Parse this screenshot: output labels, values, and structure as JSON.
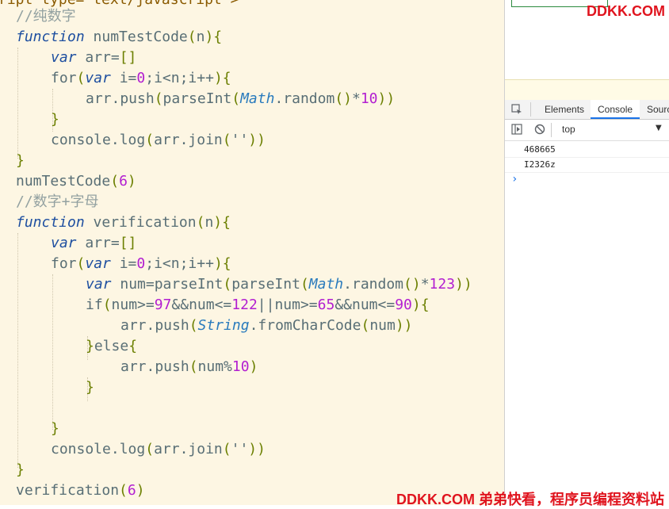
{
  "editor": {
    "lines": [
      "ript type=\"text/javascript\">",
      "//纯数字",
      "function numTestCode(n){",
      "var arr=[]",
      "for(var i=0;i<n;i++){",
      "arr.push(parseInt(Math.random()*10))",
      "}",
      "console.log(arr.join(''))",
      "}",
      "numTestCode(6)",
      "//数字+字母",
      "function verification(n){",
      "var arr=[]",
      "for(var i=0;i<n;i++){",
      "var num=parseInt(parseInt(Math.random()*123))",
      "if(num>=97&&num<=122||num>=65&&num<=90){",
      "arr.push(String.fromCharCode(num))",
      "}else{",
      "arr.push(num%10)",
      "}",
      "",
      "}",
      "console.log(arr.join(''))",
      "}",
      "verification(6)"
    ]
  },
  "devtools": {
    "tabs": [
      "Elements",
      "Console",
      "Sourc"
    ],
    "active_tab": "Console",
    "context": "top",
    "console_output": [
      "468665",
      "I2326z"
    ],
    "prompt": "›"
  },
  "watermark": {
    "top": "DDKK.COM",
    "bottom": "DDKK.COM 弟弟快看，程序员编程资料站"
  },
  "colors": {
    "editor_bg": "#fdf6e3",
    "keyword": "#2a6bb0",
    "number": "#b21fd1",
    "comment": "#93a1a1",
    "watermark": "#e0141e",
    "accent": "#1a73e8"
  }
}
